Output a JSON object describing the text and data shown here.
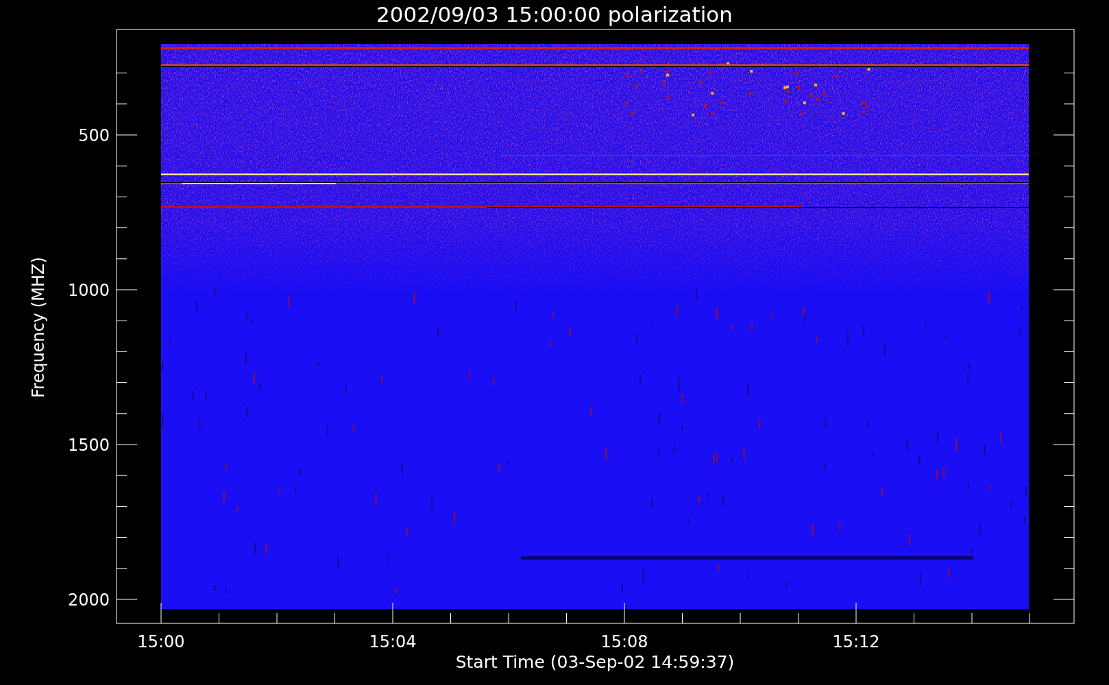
{
  "title": "2002/09/03 15:00:00 polarization",
  "ylabel": "Frequency (MHZ)",
  "xlabel": "Start Time (03-Sep-02 14:59:37)",
  "yticks": [
    "500",
    "1000",
    "1500",
    "2000"
  ],
  "xticks": [
    "15:00",
    "15:04",
    "15:08",
    "15:12"
  ]
}
